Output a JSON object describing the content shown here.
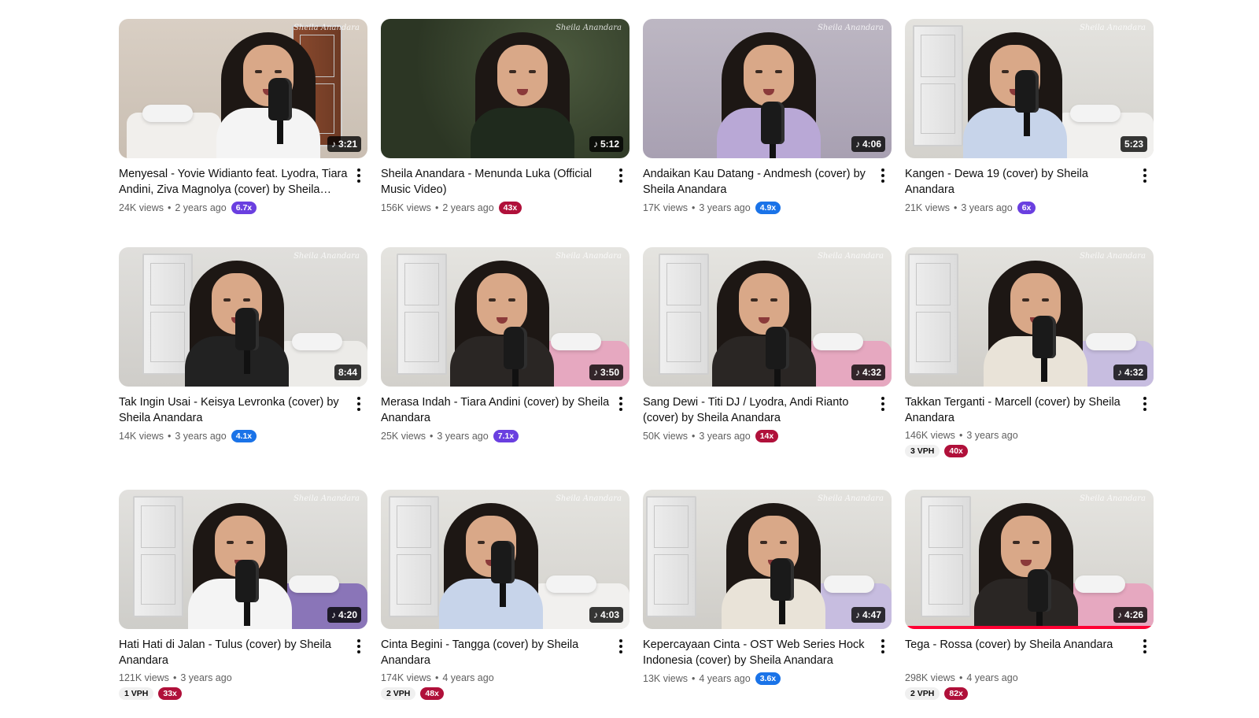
{
  "colors": {
    "badge_purple": "#6a3fe0",
    "badge_blue": "#1a73e8",
    "badge_red": "#b0103a",
    "progress_red": "#ff0033"
  },
  "watermark": "Sheila Anandara",
  "videos": [
    {
      "title": "Menyesal - Yovie Widianto feat. Lyodra, Tiara Andini, Ziva Magnolya (cover) by Sheila Anandara",
      "views": "24K views",
      "age": "2 years ago",
      "badge": "6.7x",
      "badge_color": "purple",
      "duration": "3:21",
      "music": true,
      "vph": "",
      "scene": "bedroom-warm"
    },
    {
      "title": "Sheila Anandara - Menunda Luka (Official Music Video)",
      "views": "156K views",
      "age": "2 years ago",
      "badge": "43x",
      "badge_color": "red",
      "duration": "5:12",
      "music": true,
      "vph": "",
      "scene": "forest"
    },
    {
      "title": "Andaikan Kau Datang - Andmesh (cover) by Sheila Anandara",
      "views": "17K views",
      "age": "3 years ago",
      "badge": "4.9x",
      "badge_color": "blue",
      "duration": "4:06",
      "music": true,
      "vph": "",
      "scene": "lavender"
    },
    {
      "title": "Kangen - Dewa 19 (cover) by Sheila Anandara",
      "views": "21K views",
      "age": "3 years ago",
      "badge": "6x",
      "badge_color": "purple",
      "duration": "5:23",
      "music": false,
      "vph": "",
      "scene": "bedroom-white"
    },
    {
      "title": "Tak Ingin Usai - Keisya Levronka (cover) by Sheila Anandara",
      "views": "14K views",
      "age": "3 years ago",
      "badge": "4.1x",
      "badge_color": "blue",
      "duration": "8:44",
      "music": false,
      "vph": "",
      "scene": "bedroom-grey"
    },
    {
      "title": "Merasa Indah - Tiara Andini (cover) by Sheila Anandara",
      "views": "25K views",
      "age": "3 years ago",
      "badge": "7.1x",
      "badge_color": "purple",
      "duration": "3:50",
      "music": true,
      "vph": "",
      "scene": "bedroom-pink"
    },
    {
      "title": "Sang Dewi - Titi DJ / Lyodra, Andi Rianto (cover) by Sheila Anandara",
      "views": "50K views",
      "age": "3 years ago",
      "badge": "14x",
      "badge_color": "red",
      "duration": "4:32",
      "music": true,
      "vph": "",
      "scene": "bedroom-pink"
    },
    {
      "title": "Takkan Terganti - Marcell (cover) by Sheila Anandara",
      "views": "146K views",
      "age": "3 years ago",
      "badge": "40x",
      "badge_color": "red",
      "duration": "4:32",
      "music": true,
      "vph": "3 VPH",
      "scene": "bedroom-shelf"
    },
    {
      "title": "Hati Hati di Jalan - Tulus (cover) by Sheila Anandara",
      "views": "121K views",
      "age": "3 years ago",
      "badge": "33x",
      "badge_color": "red",
      "duration": "4:20",
      "music": true,
      "vph": "1 VPH",
      "scene": "bedroom-purple"
    },
    {
      "title": "Cinta Begini - Tangga (cover) by Sheila Anandara",
      "views": "174K views",
      "age": "4 years ago",
      "badge": "48x",
      "badge_color": "red",
      "duration": "4:03",
      "music": true,
      "vph": "2 VPH",
      "scene": "bedroom-white"
    },
    {
      "title": "Kepercayaan Cinta - OST Web Series Hock Indonesia (cover) by Sheila Anandara",
      "views": "13K views",
      "age": "4 years ago",
      "badge": "3.6x",
      "badge_color": "blue",
      "duration": "4:47",
      "music": true,
      "vph": "",
      "scene": "bedroom-shelf"
    },
    {
      "title": "Tega - Rossa (cover) by Sheila Anandara",
      "views": "298K views",
      "age": "4 years ago",
      "badge": "82x",
      "badge_color": "red",
      "duration": "4:26",
      "music": true,
      "vph": "2 VPH",
      "scene": "bedroom-pink",
      "watched_progress": 1.0
    }
  ]
}
